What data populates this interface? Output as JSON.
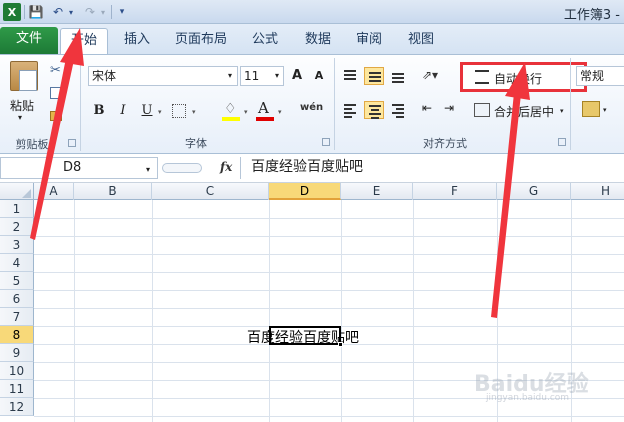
{
  "titlebar": {
    "app_icon": "X",
    "window_title": "工作簿3 -"
  },
  "tabs": [
    {
      "label": "文件"
    },
    {
      "label": "开始"
    },
    {
      "label": "插入"
    },
    {
      "label": "页面布局"
    },
    {
      "label": "公式"
    },
    {
      "label": "数据"
    },
    {
      "label": "审阅"
    },
    {
      "label": "视图"
    }
  ],
  "ribbon": {
    "clipboard": {
      "paste_label": "粘贴",
      "group_label": "剪贴板"
    },
    "font": {
      "font_name": "宋体",
      "font_size": "11",
      "grow": "A",
      "shrink": "A",
      "bold": "B",
      "italic": "I",
      "underline": "U",
      "font_color_glyph": "A",
      "phonetic": "wén",
      "group_label": "字体",
      "fill_color": "#ffff00",
      "font_color": "#e00000"
    },
    "alignment": {
      "wrap_text_label": "自动换行",
      "merge_label": "合并后居中",
      "group_label": "对齐方式",
      "highlight_color": "#e8323a"
    },
    "number": {
      "format": "常规"
    }
  },
  "formula_bar": {
    "name_box": "D8",
    "fx_label": "fx",
    "content": "百度经验百度贴吧"
  },
  "sheet": {
    "columns": [
      "A",
      "B",
      "C",
      "D",
      "E",
      "F",
      "G",
      "H"
    ],
    "rows": [
      "1",
      "2",
      "3",
      "4",
      "5",
      "6",
      "7",
      "8",
      "9",
      "10",
      "11",
      "12"
    ],
    "selected_column": "D",
    "selected_row": "8",
    "active_cell": {
      "ref": "D8",
      "value": "百度经验百度贴吧"
    }
  },
  "watermark": {
    "text": "Baidu经验",
    "sub": "jingyan.baidu.com"
  },
  "annotation": {
    "arrow_color": "#f0353d"
  }
}
